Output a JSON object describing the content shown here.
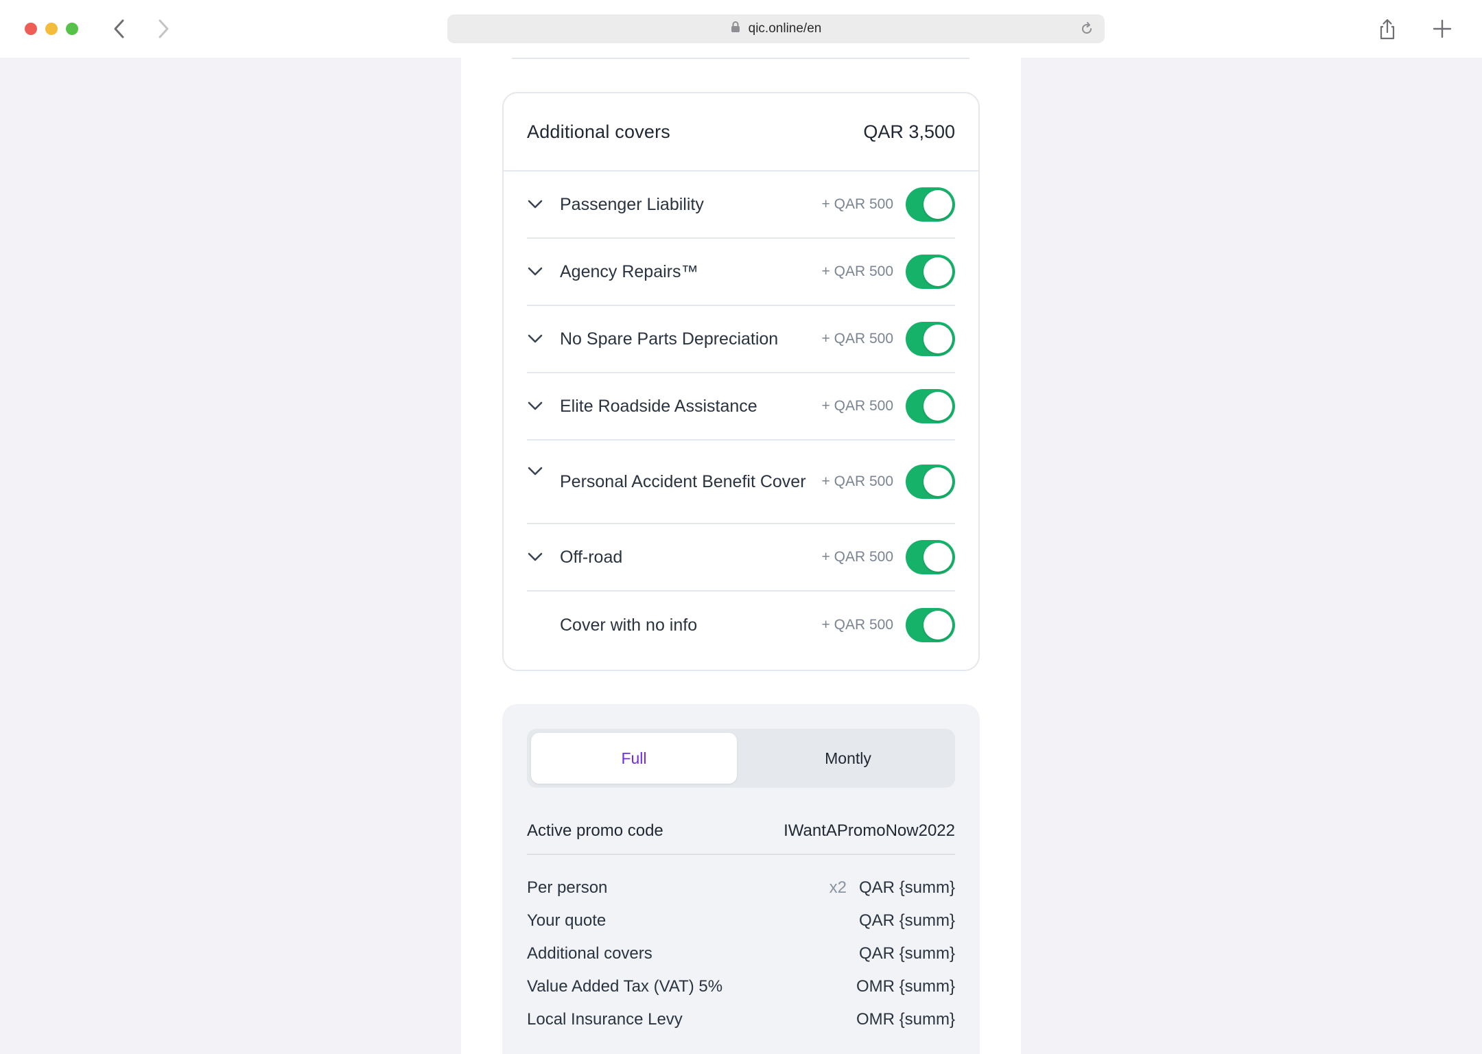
{
  "browser": {
    "url": "qic.online/en"
  },
  "covers": {
    "title": "Additional covers",
    "total": "QAR 3,500",
    "items": [
      {
        "name": "Passenger Liability",
        "price": "+ QAR 500",
        "expandable": true,
        "enabled": true
      },
      {
        "name": "Agency Repairs™",
        "price": "+ QAR 500",
        "expandable": true,
        "enabled": true
      },
      {
        "name": "No Spare Parts Depreciation",
        "price": "+ QAR 500",
        "expandable": true,
        "enabled": true
      },
      {
        "name": "Elite Roadside Assistance",
        "price": "+ QAR 500",
        "expandable": true,
        "enabled": true
      },
      {
        "name": "Personal Accident Benefit Cover",
        "price": "+ QAR 500",
        "expandable": true,
        "enabled": true
      },
      {
        "name": "Off-road",
        "price": "+ QAR 500",
        "expandable": true,
        "enabled": true
      },
      {
        "name": "Cover with no info",
        "price": "+ QAR 500",
        "expandable": false,
        "enabled": true
      }
    ]
  },
  "payment": {
    "options": [
      "Full",
      "Montly"
    ],
    "selected": "Full",
    "promo_label": "Active promo code",
    "promo_code": "IWantAPromoNow2022",
    "lines": [
      {
        "label": "Per person",
        "multiplier": "x2",
        "value": "QAR {summ}"
      },
      {
        "label": "Your quote",
        "value": "QAR {summ}"
      },
      {
        "label": "Additional covers",
        "value": "QAR {summ}"
      },
      {
        "label": "Value Added Tax (VAT) 5%",
        "value": "OMR {summ}"
      },
      {
        "label": "Local Insurance Levy",
        "value": "OMR {summ}"
      }
    ]
  },
  "colors": {
    "toggle_on": "#17b26a",
    "accent": "#6b2cf5",
    "page_bg": "#f3f3f7"
  }
}
